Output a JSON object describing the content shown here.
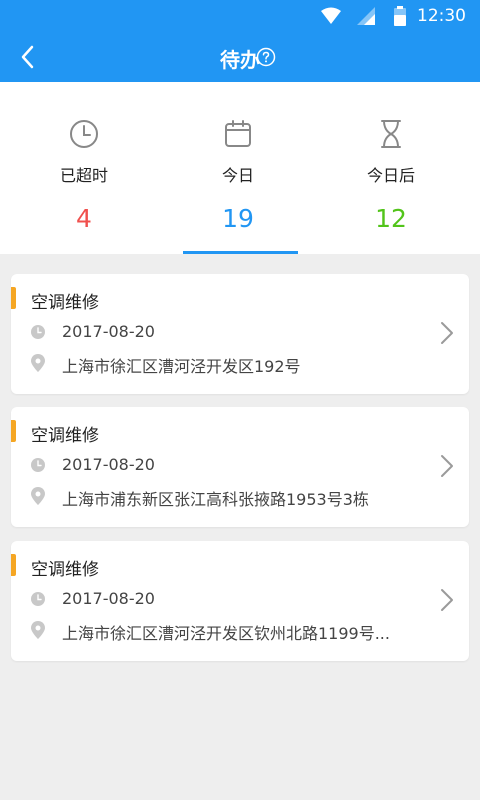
{
  "status_bar": {
    "time": "12:30",
    "icons": [
      "wifi-icon",
      "signal-icon",
      "battery-icon"
    ]
  },
  "header": {
    "title": "待办",
    "back_icon": "back-arrow-icon",
    "help_icon": "help-circle-icon"
  },
  "tabs": [
    {
      "label": "已超时",
      "count": "4",
      "icon": "clock-icon",
      "color": "#f0504d"
    },
    {
      "label": "今日",
      "count": "19",
      "icon": "calendar-icon",
      "color": "#2196f3",
      "selected": true
    },
    {
      "label": "今日后",
      "count": "12",
      "icon": "hourglass-icon",
      "color": "#52c41a"
    }
  ],
  "tasks": [
    {
      "title": "空调维修",
      "date": "2017-08-20",
      "address": "上海市徐汇区漕河泾开发区192号"
    },
    {
      "title": "空调维修",
      "date": "2017-08-20",
      "address": "上海市浦东新区张江高科张掖路1953号3栋"
    },
    {
      "title": "空调维修",
      "date": "2017-08-20",
      "address": "上海市徐汇区漕河泾开发区钦州北路1199号..."
    }
  ],
  "colors": {
    "primary": "#2196f3",
    "accent_bar": "#f5a623",
    "background": "#eeeeee"
  }
}
